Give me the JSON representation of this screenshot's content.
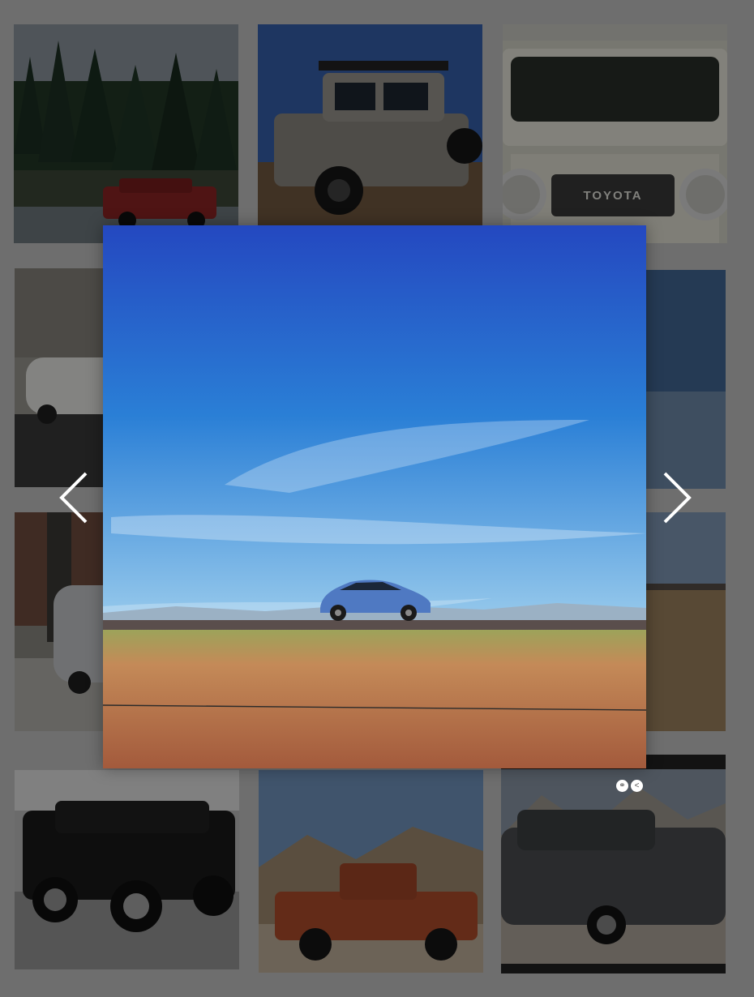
{
  "colors": {
    "backdrop": "#6e6e6e",
    "sky_top": "#1f3fbf",
    "sky_mid": "#2f8fd8",
    "field": "#b8734a",
    "car_red": "#a41e1e",
    "car_blue": "#4f79c2",
    "arrow": "#ffffff"
  },
  "grid": {
    "tiles": [
      {
        "name": "forest-creek-red-suv",
        "icon": "photo-thumbnail"
      },
      {
        "name": "silver-pickup-roof-rack",
        "icon": "photo-thumbnail"
      },
      {
        "name": "vintage-landcruiser-grille",
        "icon": "photo-thumbnail",
        "badge": "TOYOTA"
      },
      {
        "name": "white-sedan-garage",
        "icon": "photo-thumbnail"
      },
      {
        "name": "grassland-partial",
        "icon": "photo-thumbnail"
      },
      {
        "name": "gray-sedan-trees",
        "icon": "photo-thumbnail"
      },
      {
        "name": "dirt-field-partial",
        "icon": "photo-thumbnail"
      },
      {
        "name": "black-fj-cruiser",
        "icon": "photo-thumbnail"
      },
      {
        "name": "red-pickup-desert",
        "icon": "photo-thumbnail"
      },
      {
        "name": "gray-landcruiser-mountains",
        "icon": "photo-thumbnail"
      }
    ]
  },
  "lightbox": {
    "subject": "blue-hatchback-grassland",
    "prev_icon": "chevron-left-icon",
    "next_icon": "chevron-right-icon"
  },
  "tile_actions": {
    "link_icon": "link-icon",
    "share_icon": "share-icon",
    "link_glyph": "⚭",
    "share_glyph": "<"
  }
}
